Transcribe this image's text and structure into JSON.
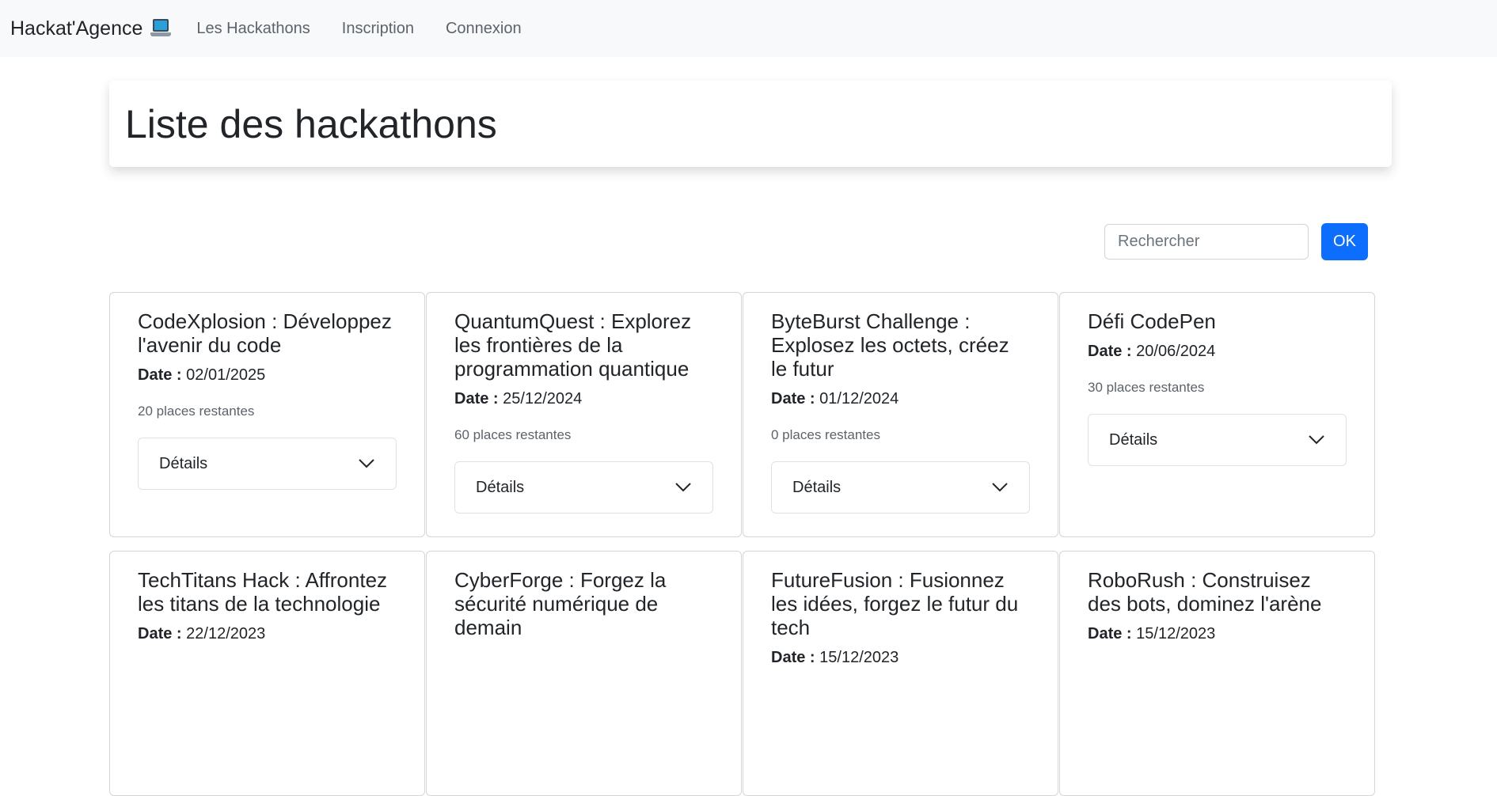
{
  "navbar": {
    "brand": "Hackat'Agence",
    "brand_icon": "laptop-icon",
    "links": [
      "Les Hackathons",
      "Inscription",
      "Connexion"
    ]
  },
  "page_title": "Liste des hackathons",
  "search": {
    "placeholder": "Rechercher",
    "button_label": "OK"
  },
  "date_label": "Date :",
  "details_label": "Détails",
  "accent_color": "#0d6efd",
  "hackathons": [
    {
      "title": "CodeXplosion : Développez l'avenir du code",
      "date": "02/01/2025",
      "places": "20 places restantes"
    },
    {
      "title": "QuantumQuest : Explorez les frontières de la programmation quantique",
      "date": "25/12/2024",
      "places": "60 places restantes"
    },
    {
      "title": "ByteBurst Challenge : Explosez les octets, créez le futur",
      "date": "01/12/2024",
      "places": "0 places restantes"
    },
    {
      "title": "Défi CodePen",
      "date": "20/06/2024",
      "places": "30 places restantes"
    },
    {
      "title": "TechTitans Hack : Affrontez les titans de la technologie",
      "date": "22/12/2023",
      "places": ""
    },
    {
      "title": "CyberForge : Forgez la sécurité numérique de demain",
      "date": "",
      "places": ""
    },
    {
      "title": "FutureFusion : Fusionnez les idées, forgez le futur du tech",
      "date": "15/12/2023",
      "places": ""
    },
    {
      "title": "RoboRush : Construisez des bots, dominez l'arène",
      "date": "15/12/2023",
      "places": ""
    }
  ]
}
